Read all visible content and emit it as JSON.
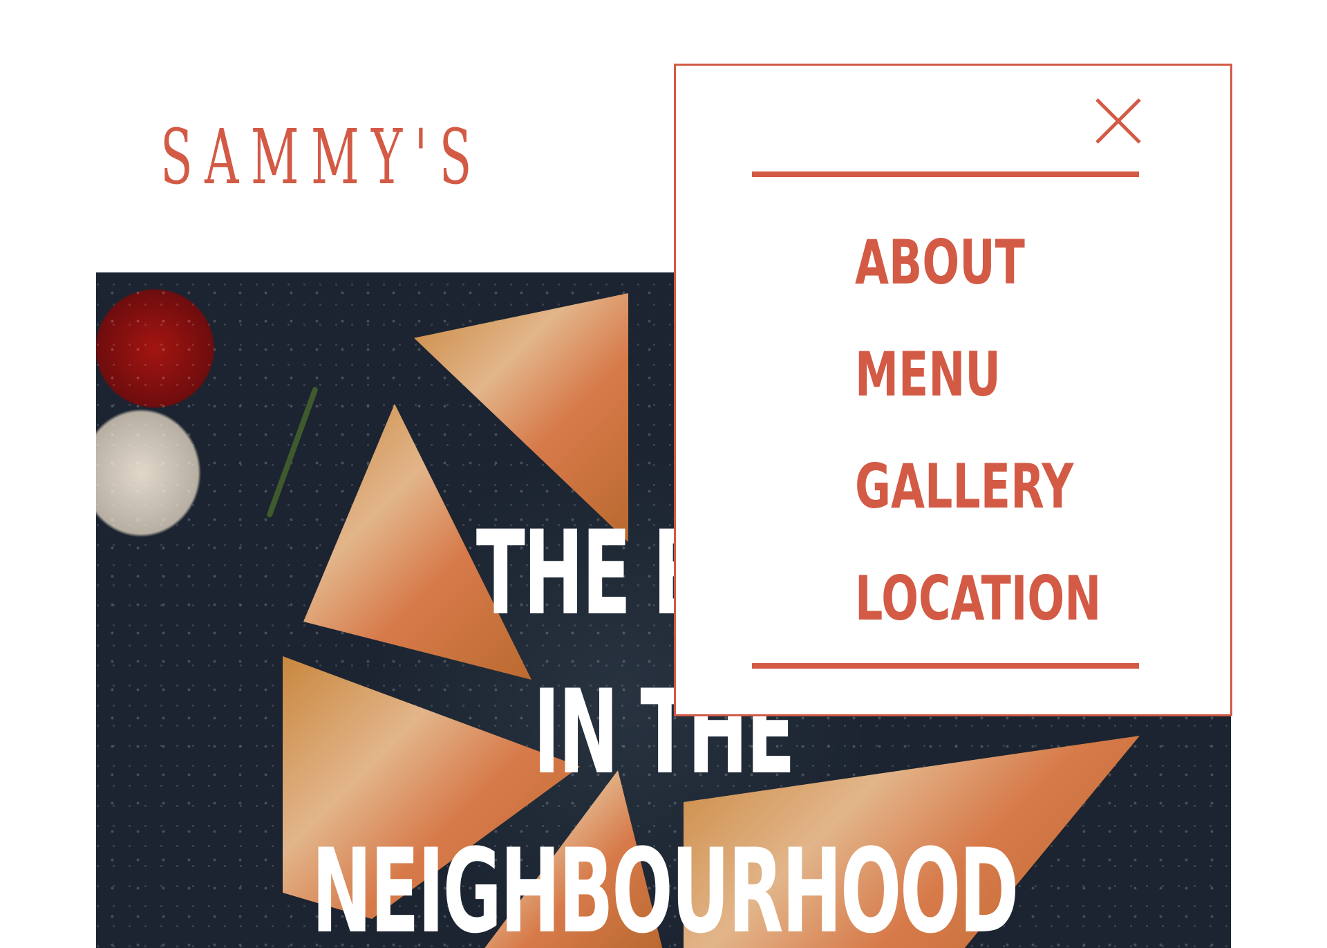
{
  "brand": {
    "logo_text": "SAMMY'S"
  },
  "hero": {
    "headline_lines": [
      "THE BEST",
      "IN THE",
      "NEIGHBOURHOOD"
    ]
  },
  "nav": {
    "close_icon": "close-icon",
    "items": [
      {
        "label": "ABOUT"
      },
      {
        "label": "MENU"
      },
      {
        "label": "GALLERY"
      },
      {
        "label": "LOCATION"
      }
    ]
  },
  "colors": {
    "accent": "#d35a45",
    "background": "#ffffff",
    "hero_text": "#ffffff"
  }
}
